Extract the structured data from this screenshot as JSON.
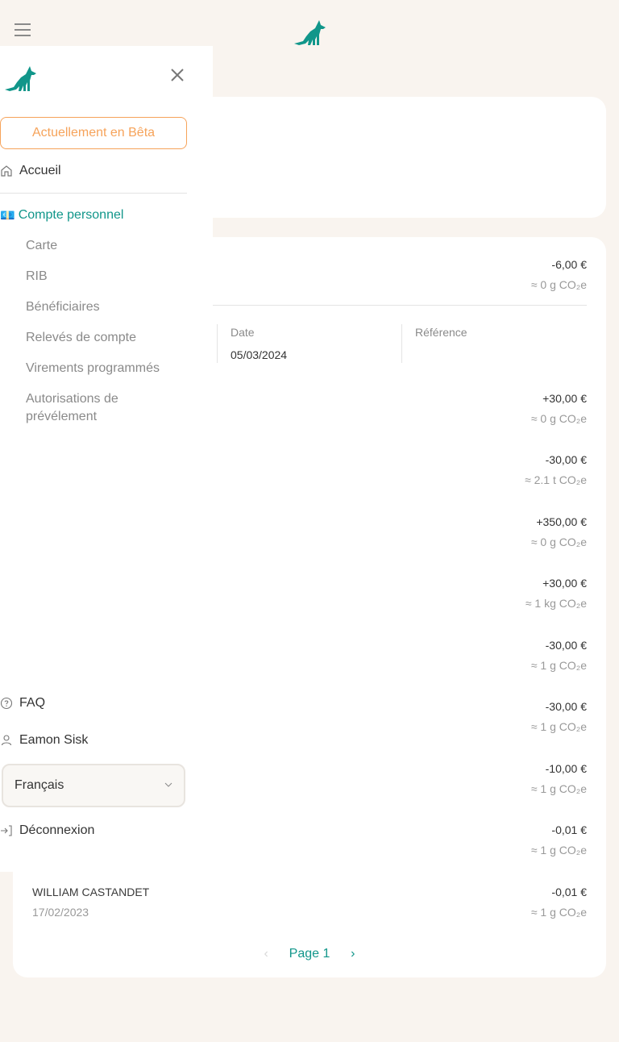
{
  "header": {
    "menu_icon": "hamburger-icon",
    "logo_icon": "fox-logo-icon"
  },
  "colors": {
    "brand": "#11968a",
    "beta": "#f6a35a",
    "background": "#f9f4ef",
    "muted": "#8a8a8a"
  },
  "sidebar": {
    "logo_icon": "fox-logo-icon",
    "close_icon": "close-icon",
    "beta_label": "Actuellement en Bêta",
    "home": {
      "icon": "home-icon",
      "label": "Accueil"
    },
    "account": {
      "icon": "euro-banknote-emoji",
      "emoji": "💶",
      "label": "Compte personnel"
    },
    "sub_items": [
      {
        "label": "Carte"
      },
      {
        "label": "RIB"
      },
      {
        "label": "Bénéficiaires"
      },
      {
        "label": "Relevés de compte"
      },
      {
        "label": "Virements programmés"
      },
      {
        "label": "Autorisations de prévélement"
      }
    ],
    "faq": {
      "icon": "help-circle-icon",
      "label": "FAQ"
    },
    "user": {
      "icon": "user-icon",
      "label": "Eamon Sisk"
    },
    "language": {
      "selected": "Français",
      "icon": "chevron-down-icon"
    },
    "logout": {
      "icon": "logout-icon",
      "label": "Déconnexion"
    }
  },
  "transactions": {
    "expanded": {
      "amount": "-6,00 €",
      "co2": "≈ 0 g CO₂e",
      "date_label": "Date",
      "date_value": "05/03/2024",
      "reference_label": "Référence",
      "reference_value": ""
    },
    "rows": [
      {
        "name": "",
        "date": "",
        "amount": "+30,00 €",
        "co2": "≈ 0 g CO₂e"
      },
      {
        "name": "",
        "date": "",
        "amount": "-30,00 €",
        "co2": "≈ 2.1 t CO₂e"
      },
      {
        "name": "",
        "date": "",
        "amount": "+350,00 €",
        "co2": "≈ 0 g CO₂e"
      },
      {
        "name": "",
        "date": "",
        "amount": "+30,00 €",
        "co2": "≈ 1 kg CO₂e"
      },
      {
        "name": "",
        "date": "",
        "amount": "-30,00 €",
        "co2": "≈ 1 g CO₂e"
      },
      {
        "name": "",
        "date": "",
        "amount": "-30,00 €",
        "co2": "≈ 1 g CO₂e"
      },
      {
        "name": "",
        "date": "",
        "amount": "-10,00 €",
        "co2": "≈ 1 g CO₂e"
      },
      {
        "name": "",
        "date": "",
        "amount": "-0,01 €",
        "co2": "≈ 1 g CO₂e"
      },
      {
        "name": "WILLIAM CASTANDET",
        "date": "17/02/2023",
        "amount": "-0,01 €",
        "co2": "≈ 1 g CO₂e"
      }
    ],
    "pagination": {
      "prev_icon": "chevron-left-icon",
      "label": "Page 1",
      "next_icon": "chevron-right-icon"
    }
  }
}
